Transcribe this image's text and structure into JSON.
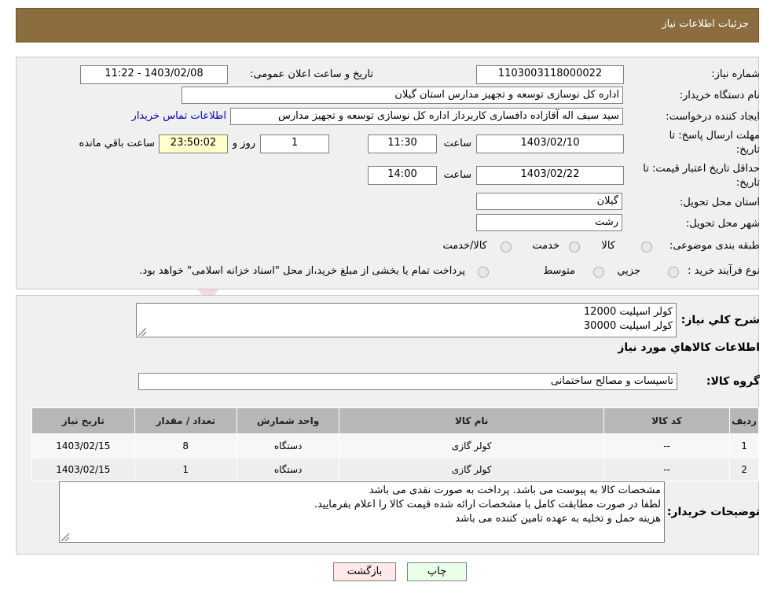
{
  "header": {
    "title": "جزئیات اطلاعات نیاز"
  },
  "form": {
    "need_number_label": "شماره نیاز:",
    "need_number": "1103003118000022",
    "announce_label": "تاریخ و ساعت اعلان عمومی:",
    "announce_value": "1403/02/08 - 11:22",
    "buyer_org_label": "نام دستگاه خریدار:",
    "buyer_org": "اداره کل نوسازی  توسعه و تجهیز مدارس استان گیلان",
    "requester_label": "ایجاد کننده درخواست:",
    "requester": "سید سیف اله آقازاده دافساری کاربرداز اداره کل نوسازی  توسعه و تجهیز مدارس",
    "buyer_contact_link": "اطلاعات تماس خریدار",
    "reply_deadline_label_1": "مهلت ارسال پاسخ: تا",
    "reply_deadline_label_2": "تاریخ:",
    "reply_date": "1403/02/10",
    "time_label": "ساعت",
    "reply_time": "11:30",
    "days_value": "1",
    "days_label": "روز و",
    "remaining_time": "23:50:02",
    "remaining_label": "ساعت باقي مانده",
    "price_valid_label_1": "حداقل تاریخ اعتبار قیمت: تا",
    "price_valid_label_2": "تاریخ:",
    "price_valid_date": "1403/02/22",
    "price_valid_time": "14:00",
    "province_label": "استان محل تحویل:",
    "province": "گیلان",
    "city_label": "شهر محل تحویل:",
    "city": "رشت",
    "category_label": "طبقه بندی موضوعی:",
    "category_options": [
      "کالا",
      "خدمت",
      "کالا/خدمت"
    ],
    "process_label": "نوع فرآیند خرید :",
    "process_options": [
      "جزیي",
      "متوسط"
    ],
    "process_note": "پرداخت تمام یا بخشی از مبلغ خرید،از محل \"اسناد خزانه اسلامی\" خواهد بود."
  },
  "summary": {
    "label": "شرح کلي نياز:",
    "lines": [
      "کولر اسپلیت 12000",
      "کولر اسپلیت 30000"
    ],
    "items_title": "اطلاعات کالاهاي مورد نياز",
    "group_label": "گروه کالا:",
    "group_value": "تاسیسات و مصالح ساختمانی"
  },
  "table": {
    "headers": [
      "رديف",
      "کد کالا",
      "نام کالا",
      "واحد شمارش",
      "تعداد / مقدار",
      "تاریخ نیاز"
    ],
    "rows": [
      [
        "1",
        "--",
        "کولر گازی",
        "دستگاه",
        "8",
        "1403/02/15"
      ],
      [
        "2",
        "--",
        "کولر گازی",
        "دستگاه",
        "1",
        "1403/02/15"
      ]
    ]
  },
  "notes": {
    "label": "توضیحات خریدار:",
    "lines": [
      "مشخصات کالا به پیوست می باشد. پرداخت به صورت نقدی می باشد",
      "لطفا در صورت مطابقت کامل با مشخصات ارائه شده قیمت کالا را اعلام بفرمایید.",
      "هزینه حمل و تخلیه به عهده تامین کننده می باشد"
    ]
  },
  "buttons": {
    "print": "چاپ",
    "back": "بازگشت"
  },
  "colors": {
    "header_bg": "#8b6d3f",
    "panel_bg": "#f0f0f0",
    "highlight": "#ffffcc",
    "print_bg": "#eaffea",
    "back_bg": "#ffe8e8"
  }
}
